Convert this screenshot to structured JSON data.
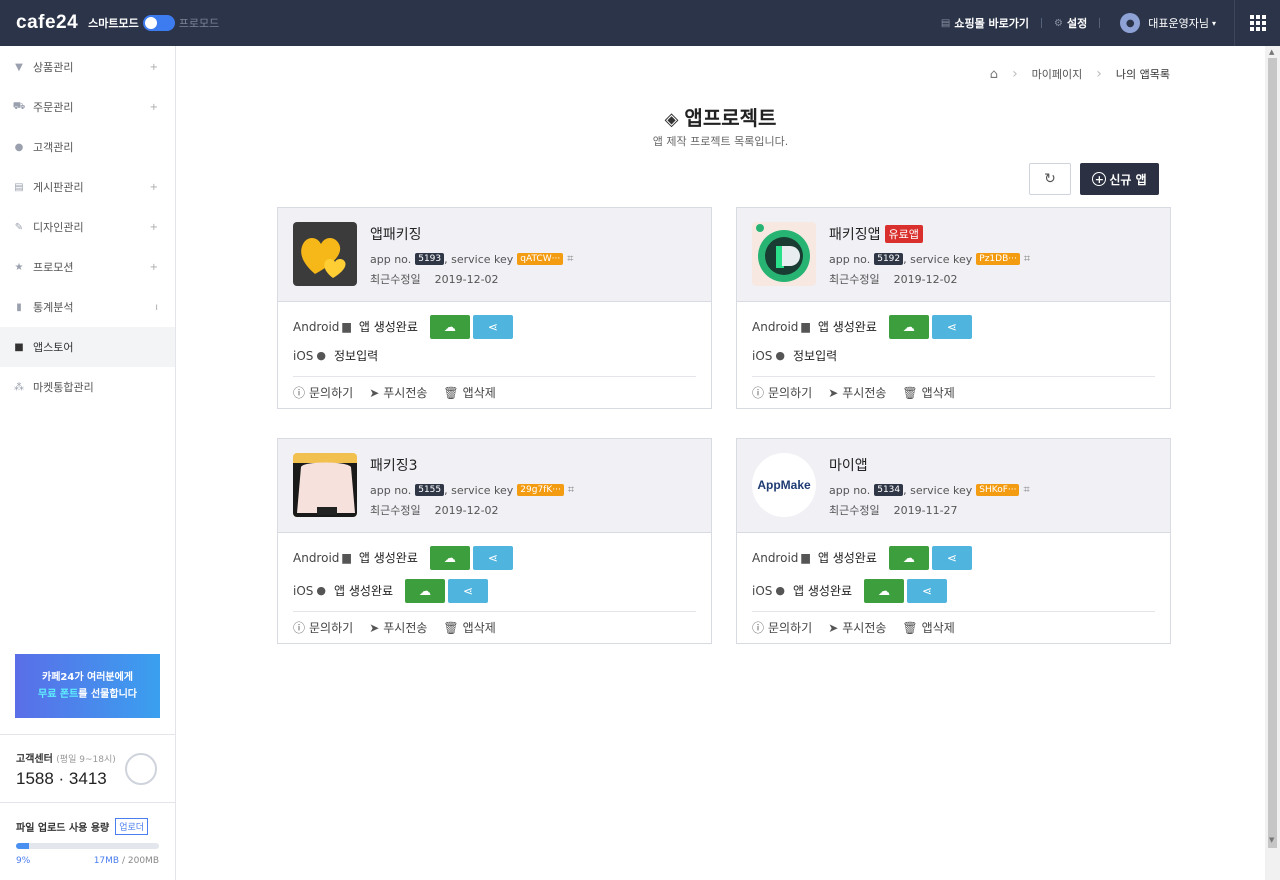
{
  "header": {
    "logo": "cafe24",
    "mode_smart": "스마트모드",
    "mode_pro": "프로모드",
    "shop_link": "쇼핑몰 바로가기",
    "settings": "설정",
    "user": "대표운영자님"
  },
  "sidebar": {
    "items": [
      {
        "label": "상품관리",
        "icon": "shirt-icon",
        "expandable": true
      },
      {
        "label": "주문관리",
        "icon": "cart-icon",
        "expandable": true
      },
      {
        "label": "고객관리",
        "icon": "person-icon",
        "expandable": false
      },
      {
        "label": "게시판관리",
        "icon": "board-icon",
        "expandable": true
      },
      {
        "label": "디자인관리",
        "icon": "brush-icon",
        "expandable": true
      },
      {
        "label": "프로모션",
        "icon": "star-icon",
        "expandable": true
      },
      {
        "label": "통계분석",
        "icon": "chart-icon",
        "expandable": true
      },
      {
        "label": "앱스토어",
        "icon": "apps-icon",
        "expandable": false
      },
      {
        "label": "마켓통합관리",
        "icon": "market-icon",
        "expandable": false
      }
    ],
    "promo_line1": "카페24가 여러분에게",
    "promo_hl": "무료 폰트",
    "promo_line2": "를 선물합니다",
    "cs_title": "고객센터",
    "cs_hours": "(평일 9~18시)",
    "cs_phone": "1588 · 3413",
    "upload_title": "파일 업로드 사용 용량",
    "upload_btn": "업로더",
    "upload_percent": "9%",
    "upload_used": "17MB",
    "upload_total": "/ 200MB",
    "upload_fraction": 0.09
  },
  "breadcrumb": {
    "home": "home",
    "level1": "마이페이지",
    "level2": "나의 앱목록"
  },
  "page": {
    "title": "앱프로젝트",
    "subtitle": "앱 제작 프로젝트 목록입니다.",
    "new_app": "신규 앱"
  },
  "labels": {
    "app_no": "app no.",
    "service_key": ", service key",
    "modified": "최근수정일",
    "android": "Android",
    "ios": "iOS",
    "inquiry": "문의하기",
    "push": "푸시전송",
    "delete": "앱삭제"
  },
  "apps": [
    {
      "name": "앱패키징",
      "paid": "",
      "app_no": "5193",
      "service_key": "qATCW···",
      "date": "2019-12-02",
      "android_status": "앱 생성완료",
      "ios_status": "정보입력"
    },
    {
      "name": "패키징앱",
      "paid": "유료앱",
      "app_no": "5192",
      "service_key": "Pz1DB···",
      "date": "2019-12-02",
      "android_status": "앱 생성완료",
      "ios_status": "정보입력"
    },
    {
      "name": "패키징3",
      "paid": "",
      "app_no": "5155",
      "service_key": "29g7fK···",
      "date": "2019-12-02",
      "android_status": "앱 생성완료",
      "ios_status": "앱 생성완료"
    },
    {
      "name": "마이앱",
      "paid": "",
      "app_no": "5134",
      "service_key": "SHKoF···",
      "date": "2019-11-27",
      "android_status": "앱 생성완료",
      "ios_status": "앱 생성완료",
      "icon_text": "AppMake"
    }
  ]
}
